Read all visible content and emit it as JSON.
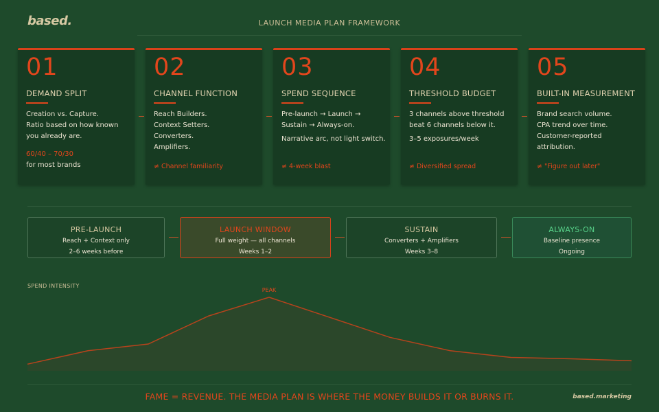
{
  "header": {
    "brand": "based.",
    "title": "LAUNCH MEDIA PLAN FRAMEWORK"
  },
  "cards": [
    {
      "number": "01",
      "heading": "DEMAND SPLIT",
      "body": [
        "Creation vs. Capture.",
        "Ratio based on how known you already are."
      ],
      "highlight": "60/40 – 70/30",
      "highlight_note": "for most brands",
      "not": ""
    },
    {
      "number": "02",
      "heading": "CHANNEL FUNCTION",
      "body": [
        "Reach Builders.",
        "Context Setters.",
        "Converters.",
        "Amplifiers."
      ],
      "not": "≠ Channel familiarity"
    },
    {
      "number": "03",
      "heading": "SPEND SEQUENCE",
      "body": [
        "Pre-launch → Launch → Sustain → Always-on."
      ],
      "body2": "Narrative arc, not light switch.",
      "not": "≠ 4-week blast"
    },
    {
      "number": "04",
      "heading": "THRESHOLD BUDGET",
      "body": [
        "3 channels above threshold beat 6 channels below it."
      ],
      "body2": "3–5 exposures/week",
      "not": "≠ Diversified spread"
    },
    {
      "number": "05",
      "heading": "BUILT-IN MEASUREMENT",
      "body": [
        "Brand search volume.",
        "CPA trend over time.",
        "Customer-reported attribution."
      ],
      "not": "≠ \"Figure out later\""
    }
  ],
  "phases": [
    {
      "name": "PRE-LAUNCH",
      "line1": "Reach + Context only",
      "line2": "2–6 weeks before",
      "state": "normal"
    },
    {
      "name": "LAUNCH WINDOW",
      "line1": "Full weight — all channels",
      "line2": "Weeks 1–2",
      "state": "active"
    },
    {
      "name": "SUSTAIN",
      "line1": "Converters + Amplifiers",
      "line2": "Weeks 3–8",
      "state": "normal"
    },
    {
      "name": "ALWAYS-ON",
      "line1": "Baseline presence",
      "line2": "Ongoing",
      "state": "evergreen"
    }
  ],
  "chart_data": {
    "type": "area",
    "title": "SPEND INTENSITY",
    "annotation": "PEAK",
    "x": [
      0,
      1,
      2,
      3,
      4,
      5,
      6,
      7,
      8,
      9,
      10
    ],
    "y": [
      10,
      30,
      40,
      82,
      110,
      80,
      50,
      30,
      20,
      18,
      15
    ],
    "ylim": [
      0,
      115
    ],
    "grid": false,
    "line_color": "#b8431c",
    "fill_color": "#2b472a"
  },
  "footer": {
    "tagline": "FAME = REVENUE. THE MEDIA PLAN IS WHERE THE MONEY BUILDS IT OR BURNS IT.",
    "brand": "based.marketing"
  }
}
